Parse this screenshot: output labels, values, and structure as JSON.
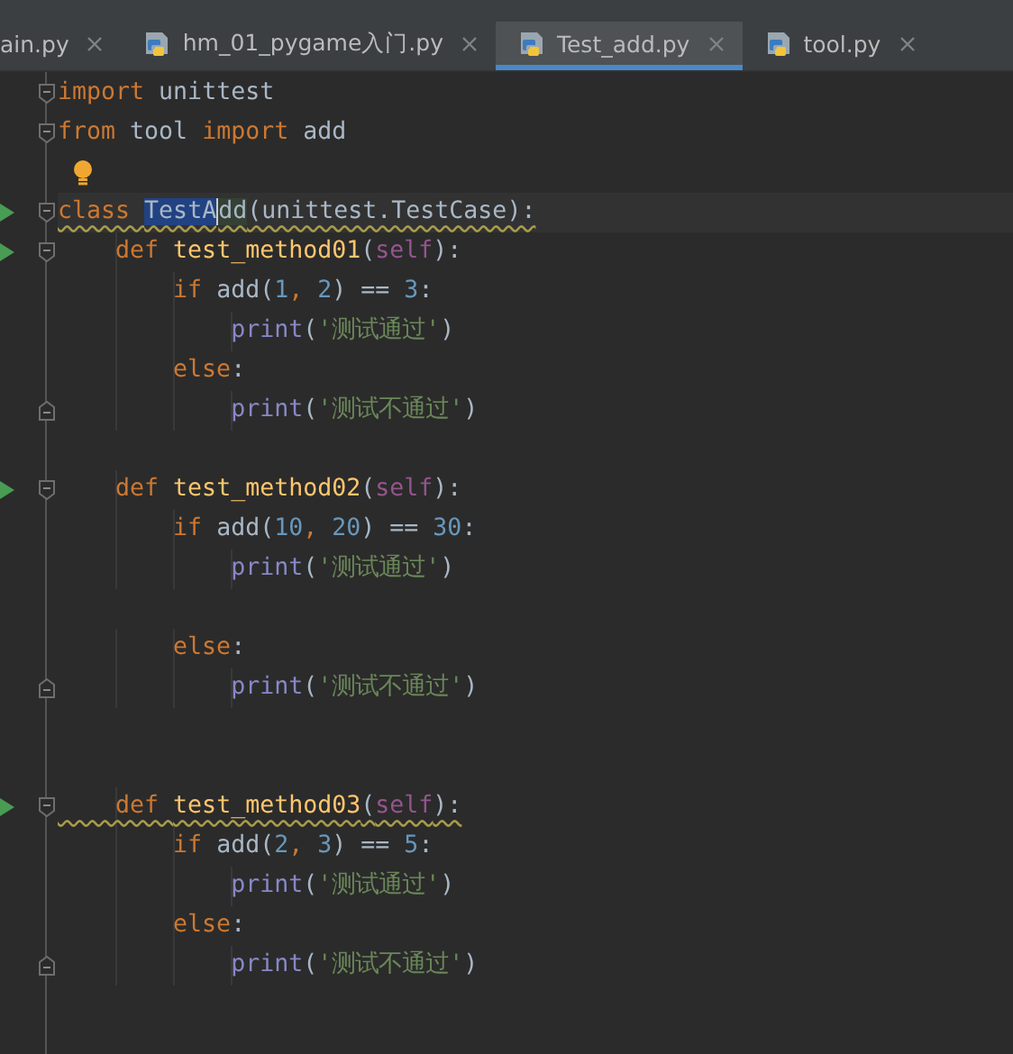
{
  "tabs": [
    {
      "label": "ain.py",
      "selected": false
    },
    {
      "label": "hm_01_pygame入门.py",
      "selected": false
    },
    {
      "label": "Test_add.py",
      "selected": true
    },
    {
      "label": "tool.py",
      "selected": false
    }
  ],
  "editor": {
    "lines": [
      {
        "fold_start": true,
        "tokens": [
          {
            "kind": "keyword",
            "text": "import "
          },
          {
            "kind": "plain",
            "text": "unittest"
          }
        ]
      },
      {
        "fold_start": true,
        "tokens": [
          {
            "kind": "keyword",
            "text": "from "
          },
          {
            "kind": "plain",
            "text": "tool "
          },
          {
            "kind": "keyword",
            "text": "import "
          },
          {
            "kind": "plain",
            "text": "add"
          }
        ]
      },
      {
        "hint": true
      },
      {
        "run": true,
        "fold_start": true,
        "current": true,
        "warning": true,
        "tokens": [
          {
            "kind": "keyword",
            "text": "class "
          },
          {
            "kind": "plain",
            "text": "TestA",
            "selected": true
          },
          {
            "kind": "plain",
            "text": "dd",
            "usage": true
          },
          {
            "kind": "plain",
            "text": "(unittest.TestCase):"
          }
        ]
      },
      {
        "run": true,
        "fold_start": true,
        "tokens": [
          {
            "kind": "keyword",
            "text": "    def "
          },
          {
            "kind": "function",
            "text": "test_method01"
          },
          {
            "kind": "plain",
            "text": "("
          },
          {
            "kind": "self",
            "text": "self"
          },
          {
            "kind": "plain",
            "text": "):"
          }
        ]
      },
      {
        "tokens": [
          {
            "kind": "keyword",
            "text": "        if "
          },
          {
            "kind": "plain",
            "text": "add("
          },
          {
            "kind": "number",
            "text": "1"
          },
          {
            "kind": "keyword",
            "text": ", "
          },
          {
            "kind": "number",
            "text": "2"
          },
          {
            "kind": "plain",
            "text": ") == "
          },
          {
            "kind": "number",
            "text": "3"
          },
          {
            "kind": "plain",
            "text": ":"
          }
        ]
      },
      {
        "tokens": [
          {
            "kind": "builtin",
            "text": "            print"
          },
          {
            "kind": "plain",
            "text": "("
          },
          {
            "kind": "string",
            "text": "'测试通过'"
          },
          {
            "kind": "plain",
            "text": ")"
          }
        ]
      },
      {
        "tokens": [
          {
            "kind": "keyword",
            "text": "        else"
          },
          {
            "kind": "plain",
            "text": ":"
          }
        ]
      },
      {
        "fold_end": true,
        "tokens": [
          {
            "kind": "builtin",
            "text": "            print"
          },
          {
            "kind": "plain",
            "text": "("
          },
          {
            "kind": "string",
            "text": "'测试不通过'"
          },
          {
            "kind": "plain",
            "text": ")"
          }
        ]
      },
      {
        "blank": true
      },
      {
        "run": true,
        "fold_start": true,
        "tokens": [
          {
            "kind": "keyword",
            "text": "    def "
          },
          {
            "kind": "function",
            "text": "test_method02"
          },
          {
            "kind": "plain",
            "text": "("
          },
          {
            "kind": "self",
            "text": "self"
          },
          {
            "kind": "plain",
            "text": "):"
          }
        ]
      },
      {
        "tokens": [
          {
            "kind": "keyword",
            "text": "        if "
          },
          {
            "kind": "plain",
            "text": "add("
          },
          {
            "kind": "number",
            "text": "10"
          },
          {
            "kind": "keyword",
            "text": ", "
          },
          {
            "kind": "number",
            "text": "20"
          },
          {
            "kind": "plain",
            "text": ") == "
          },
          {
            "kind": "number",
            "text": "30"
          },
          {
            "kind": "plain",
            "text": ":"
          }
        ]
      },
      {
        "tokens": [
          {
            "kind": "builtin",
            "text": "            print"
          },
          {
            "kind": "plain",
            "text": "("
          },
          {
            "kind": "string",
            "text": "'测试通过'"
          },
          {
            "kind": "plain",
            "text": ")"
          }
        ]
      },
      {
        "blank": true
      },
      {
        "tokens": [
          {
            "kind": "keyword",
            "text": "        else"
          },
          {
            "kind": "plain",
            "text": ":"
          }
        ]
      },
      {
        "fold_end": true,
        "tokens": [
          {
            "kind": "builtin",
            "text": "            print"
          },
          {
            "kind": "plain",
            "text": "("
          },
          {
            "kind": "string",
            "text": "'测试不通过'"
          },
          {
            "kind": "plain",
            "text": ")"
          }
        ]
      },
      {
        "blank": true
      },
      {
        "blank": true
      },
      {
        "run": true,
        "fold_start": true,
        "warning": true,
        "tokens": [
          {
            "kind": "keyword",
            "text": "    def "
          },
          {
            "kind": "function",
            "text": "test_method03"
          },
          {
            "kind": "plain",
            "text": "("
          },
          {
            "kind": "self",
            "text": "self"
          },
          {
            "kind": "plain",
            "text": "):"
          }
        ]
      },
      {
        "tokens": [
          {
            "kind": "keyword",
            "text": "        if "
          },
          {
            "kind": "plain",
            "text": "add("
          },
          {
            "kind": "number",
            "text": "2"
          },
          {
            "kind": "keyword",
            "text": ", "
          },
          {
            "kind": "number",
            "text": "3"
          },
          {
            "kind": "plain",
            "text": ") == "
          },
          {
            "kind": "number",
            "text": "5"
          },
          {
            "kind": "plain",
            "text": ":"
          }
        ]
      },
      {
        "tokens": [
          {
            "kind": "builtin",
            "text": "            print"
          },
          {
            "kind": "plain",
            "text": "("
          },
          {
            "kind": "string",
            "text": "'测试通过'"
          },
          {
            "kind": "plain",
            "text": ")"
          }
        ]
      },
      {
        "tokens": [
          {
            "kind": "keyword",
            "text": "        else"
          },
          {
            "kind": "plain",
            "text": ":"
          }
        ]
      },
      {
        "fold_end": true,
        "tokens": [
          {
            "kind": "builtin",
            "text": "            print"
          },
          {
            "kind": "plain",
            "text": "("
          },
          {
            "kind": "string",
            "text": "'测试不通过'"
          },
          {
            "kind": "plain",
            "text": ")"
          }
        ]
      }
    ]
  }
}
